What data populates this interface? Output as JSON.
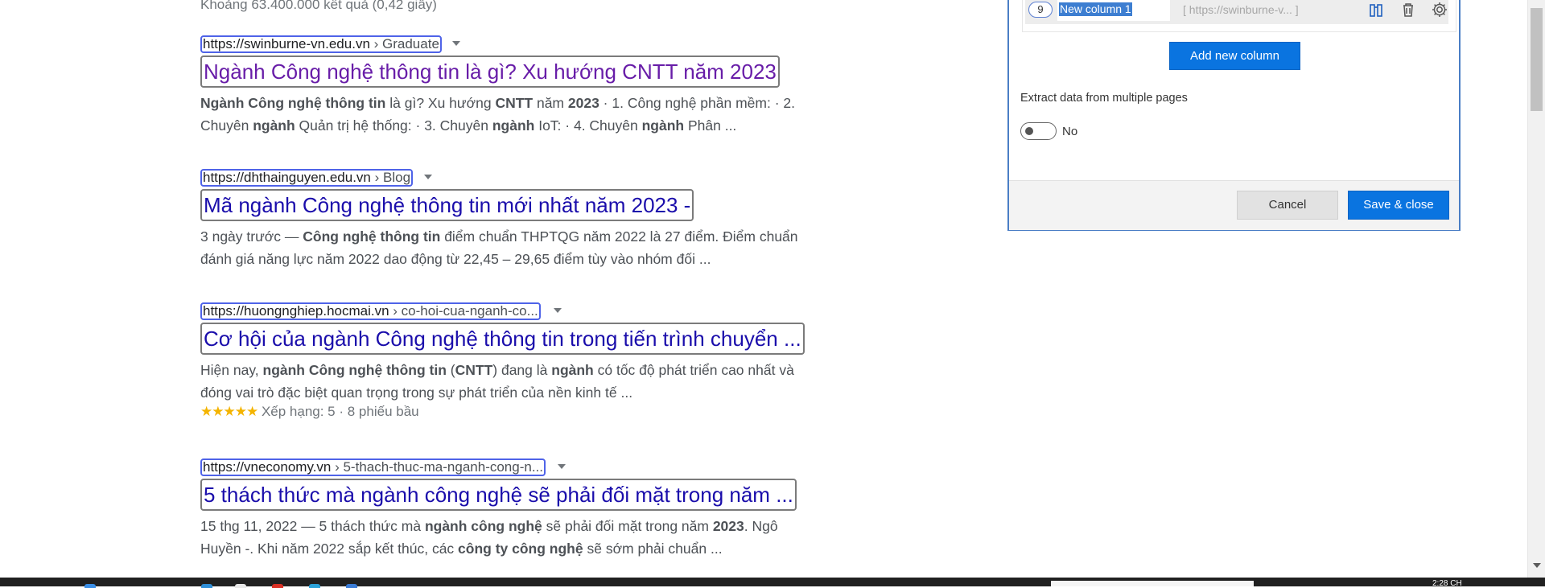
{
  "search": {
    "result_count": "Khoảng 63.400.000 kết quả (0,42 giây)",
    "results": [
      {
        "url": "https://swinburne-vn.edu.vn",
        "crumb": " › Graduate",
        "title": "Ngành Công nghệ thông tin là gì? Xu hướng CNTT năm 2023",
        "snippet_parts": [
          {
            "t": "Ngành Công nghệ thông tin",
            "b": true
          },
          {
            "t": " là gì? Xu hướng ",
            "b": false
          },
          {
            "t": "CNTT",
            "b": true
          },
          {
            "t": " năm ",
            "b": false
          },
          {
            "t": "2023",
            "b": true
          },
          {
            "t": " · 1. Công nghệ phần mềm: · 2. Chuyên ",
            "b": false
          },
          {
            "t": "ngành",
            "b": true
          },
          {
            "t": " Quản trị hệ thống: · 3. Chuyên ",
            "b": false
          },
          {
            "t": "ngành",
            "b": true
          },
          {
            "t": " IoT: · 4. Chuyên ",
            "b": false
          },
          {
            "t": "ngành",
            "b": true
          },
          {
            "t": " Phân ...",
            "b": false
          }
        ]
      },
      {
        "url": "https://dhthainguyen.edu.vn",
        "crumb": " › Blog",
        "title": "Mã ngành Công nghệ thông tin mới nhất năm 2023 -",
        "snippet_parts": [
          {
            "t": "3 ngày trước — ",
            "b": false
          },
          {
            "t": "Công nghệ thông tin",
            "b": true
          },
          {
            "t": " điểm chuẩn THPTQG năm 2022 là 27 điểm. Điểm chuẩn đánh giá năng lực năm 2022 dao động từ 22,45 – 29,65 điểm tùy vào nhóm đối ...",
            "b": false
          }
        ]
      },
      {
        "url": "https://huongnghiep.hocmai.vn",
        "crumb": " › co-hoi-cua-nganh-co...",
        "title": "Cơ hội của ngành Công nghệ thông tin trong tiến trình chuyển ...",
        "snippet_parts": [
          {
            "t": "Hiện nay, ",
            "b": false
          },
          {
            "t": "ngành Công nghệ thông tin",
            "b": true
          },
          {
            "t": " (",
            "b": false
          },
          {
            "t": "CNTT",
            "b": true
          },
          {
            "t": ") đang là ",
            "b": false
          },
          {
            "t": "ngành",
            "b": true
          },
          {
            "t": " có tốc độ phát triển cao nhất và đóng vai trò đặc biệt quan trọng trong sự phát triển của nền kinh tế ...",
            "b": false
          }
        ],
        "stars": "★★★★★",
        "rating": "Xếp hạng: 5",
        "votes": " · 8 phiếu bầu"
      },
      {
        "url": "https://vneconomy.vn",
        "crumb": " › 5-thach-thuc-ma-nganh-cong-n...",
        "title": "5 thách thức mà ngành công nghệ sẽ phải đối mặt trong năm ...",
        "snippet_parts": [
          {
            "t": "15 thg 11, 2022 — 5 thách thức mà ",
            "b": false
          },
          {
            "t": "ngành công nghệ",
            "b": true
          },
          {
            "t": " sẽ phải đối mặt trong năm ",
            "b": false
          },
          {
            "t": "2023",
            "b": true
          },
          {
            "t": ". Ngô Huyền -. Khi năm 2022 sắp kết thúc, các ",
            "b": false
          },
          {
            "t": "công ty công nghệ",
            "b": true
          },
          {
            "t": " sẽ sớm phải chuẩn ...",
            "b": false
          }
        ]
      }
    ]
  },
  "panel": {
    "column": {
      "number": "9",
      "name": "New column 1",
      "url_preview": "[ https://swinburne-v... ]"
    },
    "add_column_label": "Add new column",
    "extract_label": "Extract data from multiple pages",
    "toggle_text": "No",
    "cancel_label": "Cancel",
    "save_label": "Save & close"
  },
  "taskbar": {
    "clock": "2:28 CH"
  },
  "colors": {
    "accent": "#0a74e0",
    "link_visited": "#681da8",
    "link": "#1a0dab",
    "highlight_border": "#4f63e8"
  }
}
